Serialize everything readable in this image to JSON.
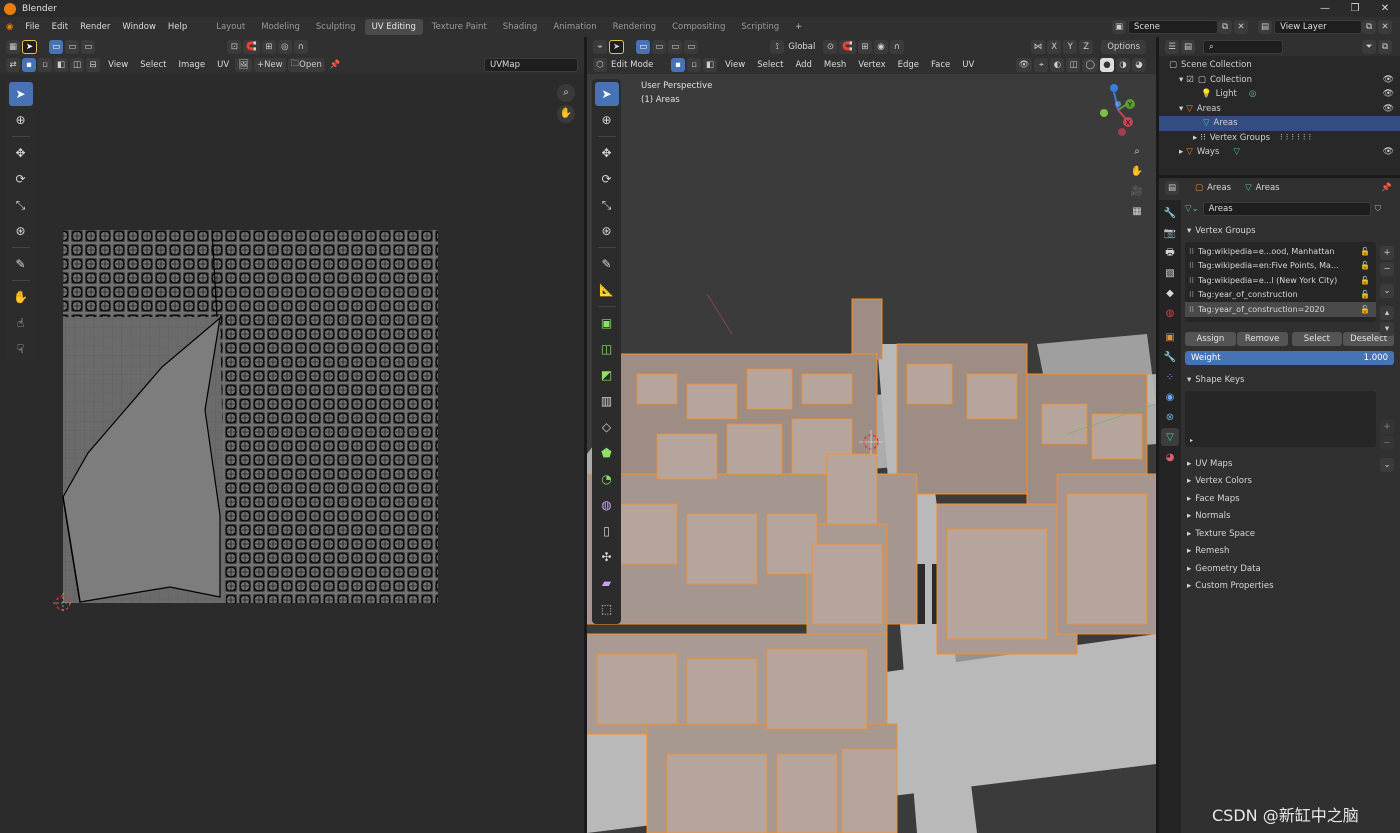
{
  "window": {
    "title": "Blender",
    "controls": [
      "—",
      "❐",
      "✕"
    ]
  },
  "menu": [
    "File",
    "Edit",
    "Render",
    "Window",
    "Help"
  ],
  "workspaces": [
    "Layout",
    "Modeling",
    "Sculpting",
    "UV Editing",
    "Texture Paint",
    "Shading",
    "Animation",
    "Rendering",
    "Compositing",
    "Scripting"
  ],
  "active_workspace": "UV Editing",
  "scene": {
    "name": "Scene",
    "view_layer": "View Layer"
  },
  "uv_editor": {
    "menus": [
      "View",
      "Select",
      "Image",
      "UV"
    ],
    "new_label": "New",
    "open_label": "Open",
    "uvmap": "UVMap"
  },
  "viewport": {
    "orientation": "Global",
    "options_label": "Options",
    "mode": "Edit Mode",
    "menus": [
      "View",
      "Select",
      "Add",
      "Mesh",
      "Vertex",
      "Edge",
      "Face",
      "UV"
    ],
    "overlay_title": "User Perspective",
    "overlay_object": "(1) Areas",
    "axes": {
      "x": "X",
      "y": "Y",
      "z": "Z"
    }
  },
  "outliner": {
    "rows": [
      {
        "label": "Scene Collection",
        "indent": 0
      },
      {
        "label": "Collection",
        "indent": 1
      },
      {
        "label": "Light",
        "indent": 2
      },
      {
        "label": "Areas",
        "indent": 1
      },
      {
        "label": "Areas",
        "indent": 2
      },
      {
        "label": "Vertex Groups",
        "indent": 2
      },
      {
        "label": "Ways",
        "indent": 1
      }
    ]
  },
  "properties": {
    "breadcrumb": [
      "Areas",
      "Areas"
    ],
    "mesh_name": "Areas",
    "vertex_groups_title": "Vertex Groups",
    "vertex_groups": [
      "Tag:wikipedia=e...ood, Manhattan",
      "Tag:wikipedia=en:Five Points, Ma...",
      "Tag:wikipedia=e...l (New York City)",
      "Tag:year_of_construction",
      "Tag:year_of_construction=2020"
    ],
    "buttons": {
      "assign": "Assign",
      "remove": "Remove",
      "select": "Select",
      "deselect": "Deselect"
    },
    "weight_label": "Weight",
    "weight_value": "1.000",
    "shape_keys_title": "Shape Keys",
    "panels": [
      "UV Maps",
      "Vertex Colors",
      "Face Maps",
      "Normals",
      "Texture Space",
      "Remesh",
      "Geometry Data",
      "Custom Properties"
    ]
  },
  "watermark": "CSDN @新缸中之脑",
  "colors": {
    "accent": "#4772b3",
    "selection_orange": "#ff8c1a",
    "building": "#9d8d85"
  }
}
